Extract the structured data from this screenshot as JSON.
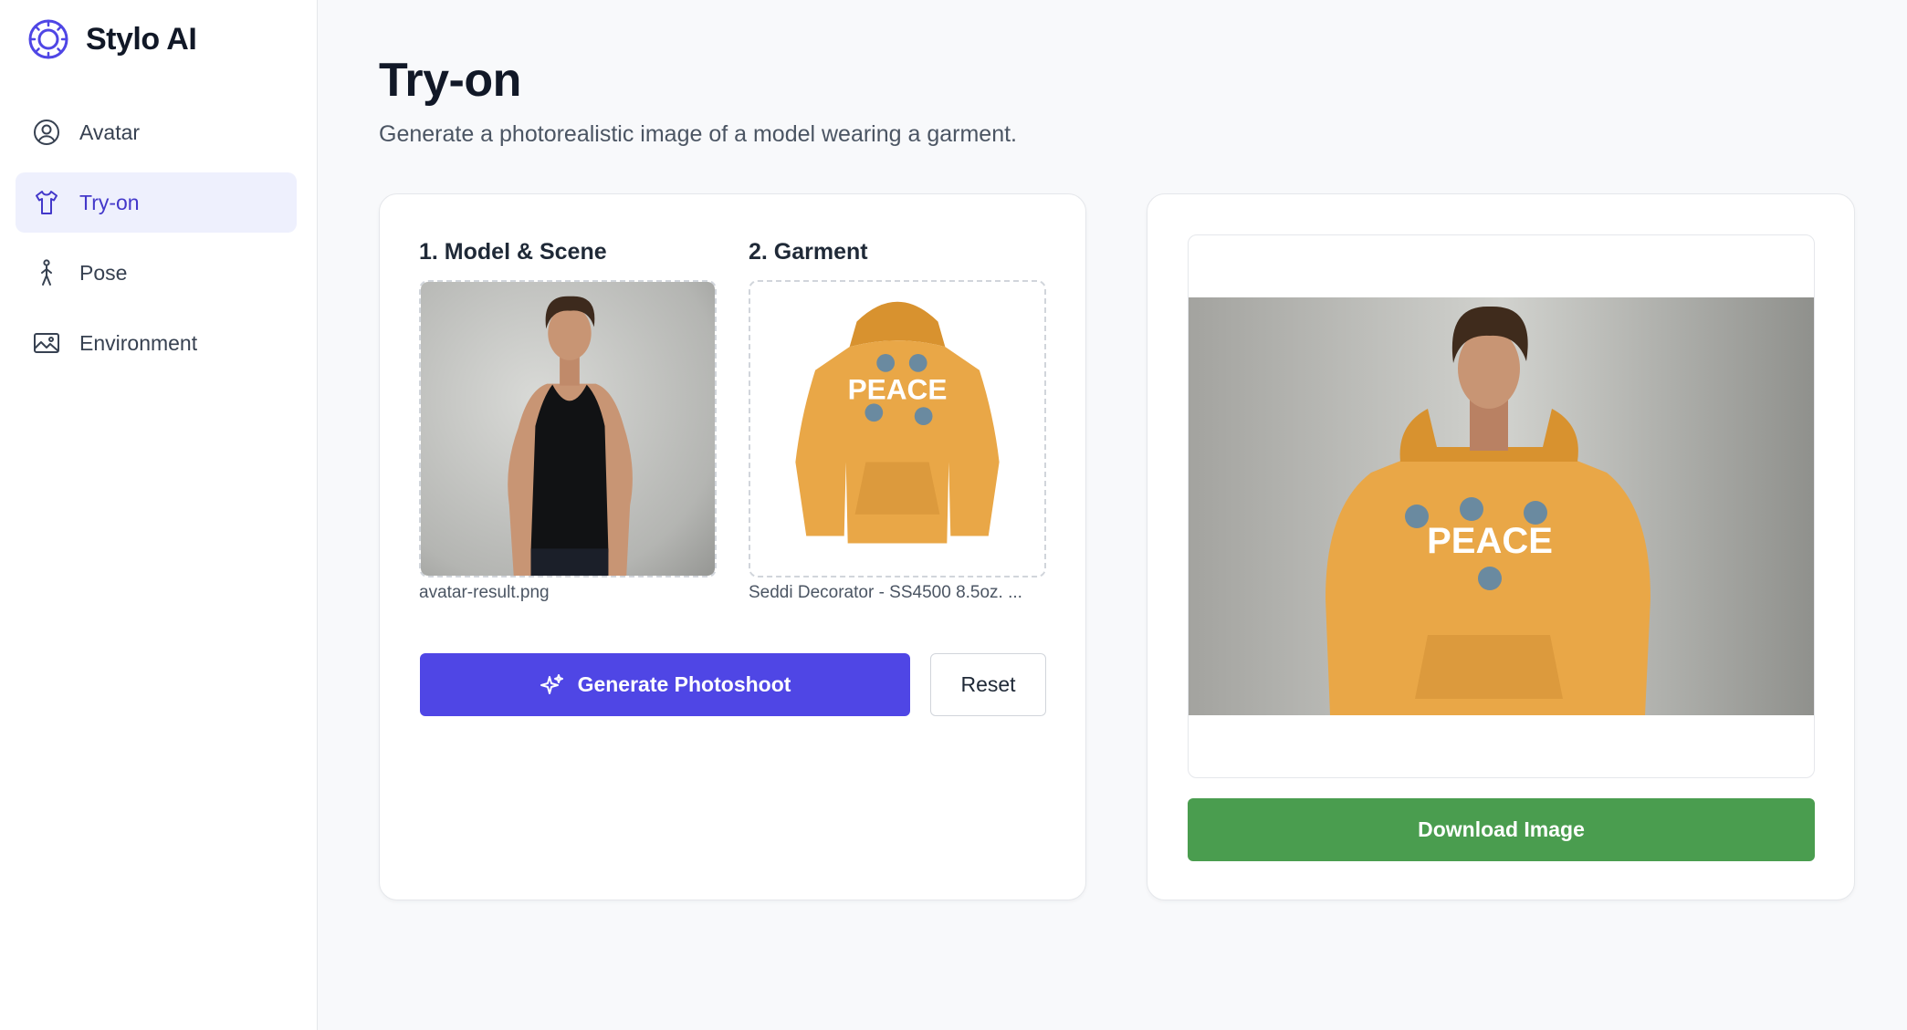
{
  "app": {
    "name": "Stylo AI",
    "logo_icon": "aperture-logo-icon"
  },
  "sidebar": {
    "items": [
      {
        "label": "Avatar",
        "icon": "user-circle-icon",
        "active": false
      },
      {
        "label": "Try-on",
        "icon": "shirt-icon",
        "active": true
      },
      {
        "label": "Pose",
        "icon": "person-walking-icon",
        "active": false
      },
      {
        "label": "Environment",
        "icon": "image-landscape-icon",
        "active": false
      }
    ]
  },
  "page": {
    "title": "Try-on",
    "subtitle": "Generate a photorealistic image of a model wearing a garment."
  },
  "inputs": {
    "model": {
      "label": "1. Model & Scene",
      "file_name": "avatar-result.png"
    },
    "garment": {
      "label": "2. Garment",
      "file_name": "Seddi Decorator - SS4500 8.5oz. ...",
      "print_text": "PEACE"
    }
  },
  "actions": {
    "generate_label": "Generate Photoshoot",
    "reset_label": "Reset",
    "download_label": "Download Image"
  },
  "colors": {
    "accent": "#4f46e5",
    "active_nav_bg": "#eef0fd",
    "download": "#4a9d4f",
    "garment": "#e9a747"
  }
}
